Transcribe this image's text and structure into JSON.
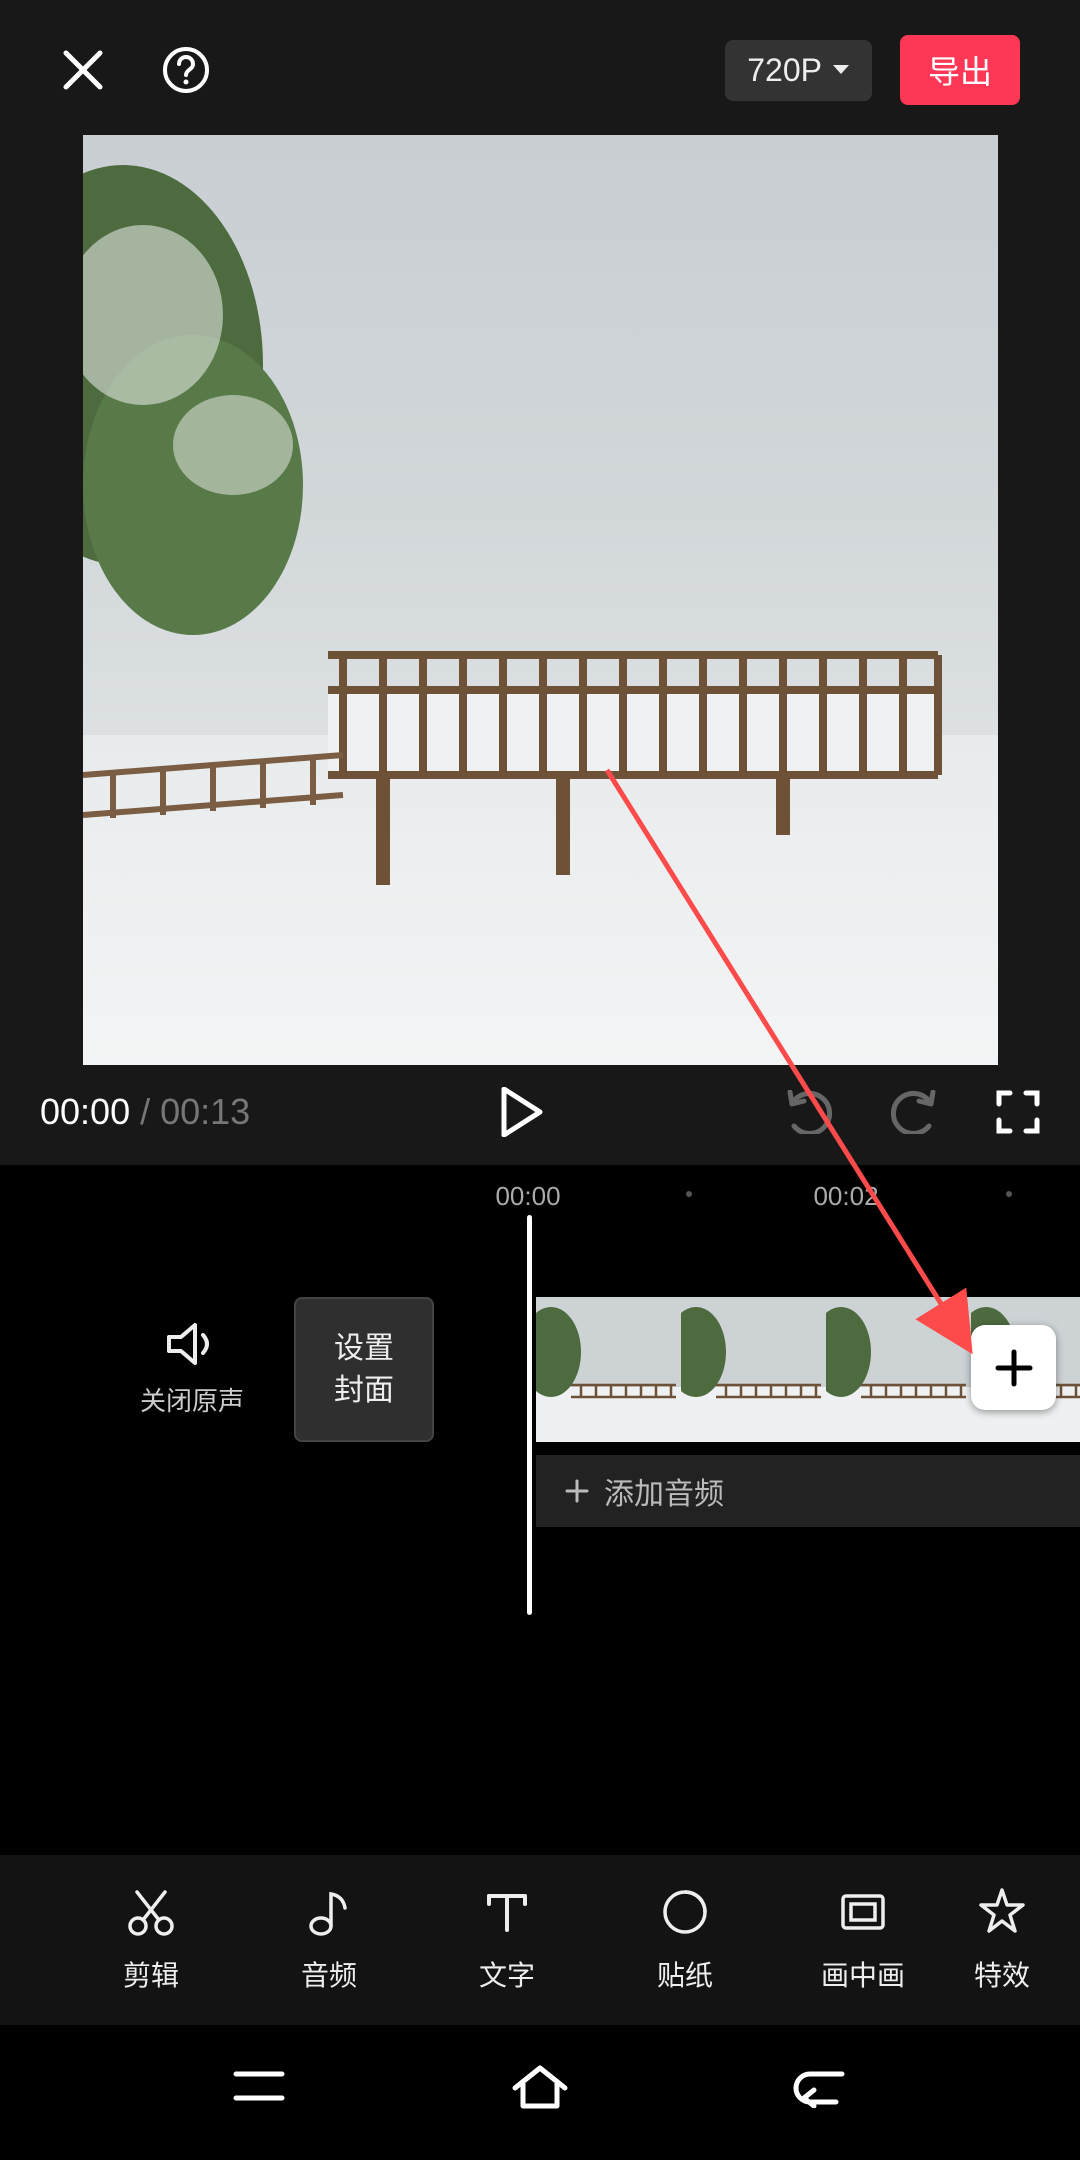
{
  "header": {
    "resolution_label": "720P",
    "export_label": "导出"
  },
  "controls": {
    "current_time": "00:00",
    "separator": "/",
    "total_time": "00:13"
  },
  "ruler": {
    "ticks": [
      "00:00",
      "00:02"
    ]
  },
  "timeline": {
    "mute_label": "关闭原声",
    "cover_line1": "设置",
    "cover_line2": "封面",
    "add_audio_label": "添加音频"
  },
  "tools": [
    {
      "id": "cut",
      "label": "剪辑"
    },
    {
      "id": "audio",
      "label": "音频"
    },
    {
      "id": "text",
      "label": "文字"
    },
    {
      "id": "sticker",
      "label": "贴纸"
    },
    {
      "id": "pip",
      "label": "画中画"
    },
    {
      "id": "fx",
      "label": "特效"
    }
  ]
}
